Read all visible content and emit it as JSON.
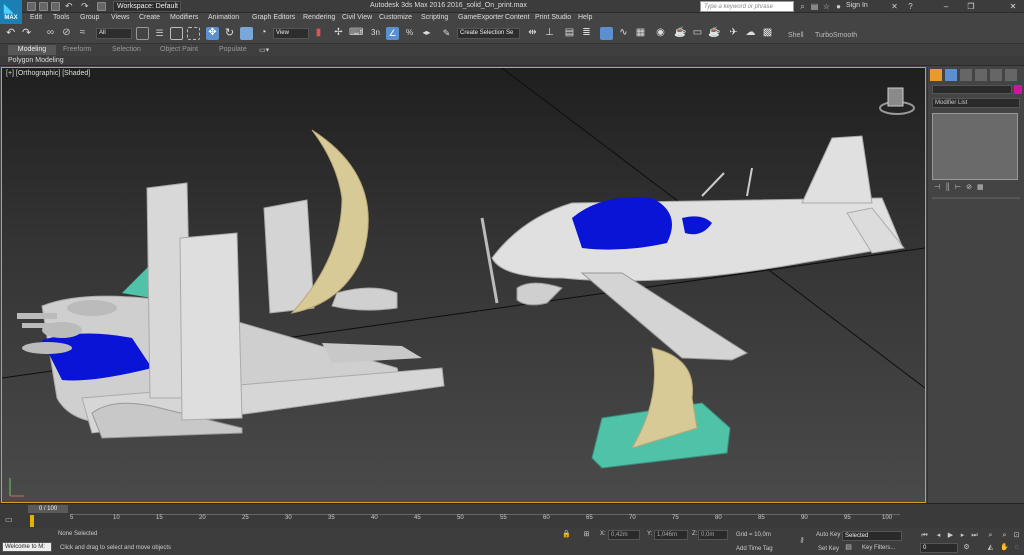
{
  "app": {
    "logo_text": "MAX",
    "window_title": "Autodesk 3ds Max 2016     2016_solid_On_print.max",
    "workspace": "Workspace: Default"
  },
  "search": {
    "placeholder": "Type a keyword or phrase"
  },
  "account": {
    "sign_in": "Sign In"
  },
  "menu": [
    "Edit",
    "Tools",
    "Group",
    "Views",
    "Create",
    "Modifiers",
    "Animation",
    "Graph Editors",
    "Rendering",
    "Civil View",
    "Customize",
    "Scripting",
    "GameExporter",
    "Content",
    "Print Studio",
    "Help"
  ],
  "toolbar": {
    "selection_filter": "All",
    "ref_coord": "View",
    "named_selection": "Create Selection Se"
  },
  "ribbon": {
    "tabs": [
      "Modeling",
      "Freeform",
      "Selection",
      "Object Paint",
      "Populate"
    ],
    "active": "Modeling",
    "sub_label": "Polygon Modeling",
    "extra": [
      "Shell",
      "TurboSmooth"
    ]
  },
  "viewport": {
    "label": "[+] [Orthographic] [Shaded]"
  },
  "command_panel": {
    "modifier_list": "Modifier List",
    "color_swatch": "#c8199a"
  },
  "timeline": {
    "position": "0 / 100",
    "ticks": [
      "5",
      "10",
      "15",
      "20",
      "25",
      "30",
      "35",
      "40",
      "45",
      "50",
      "55",
      "60",
      "65",
      "70",
      "75",
      "80",
      "85",
      "90",
      "95",
      "100"
    ]
  },
  "status": {
    "script_listener": "Welcome to M:",
    "selection": "None Selected",
    "prompt": "Click and drag to select and move objects",
    "x_label": "X:",
    "x": "0,42m",
    "y_label": "Y:",
    "y": "1,046m",
    "z_label": "Z:",
    "z": "0,0m",
    "grid": "Grid = 10,0m",
    "add_time_tag": "Add Time Tag",
    "auto_key": "Auto Key",
    "set_key": "Set Key",
    "key_mode": "Selected",
    "key_filters": "Key Filters...",
    "frame": "0"
  },
  "colors": {
    "accent": "#5b8fcf",
    "viewport_border": "#d4a21d",
    "model_gray": "#d9d9d9",
    "canopy_blue": "#0a14d6",
    "stand_tan": "#d8ca96",
    "base_teal": "#4fc2a8"
  }
}
